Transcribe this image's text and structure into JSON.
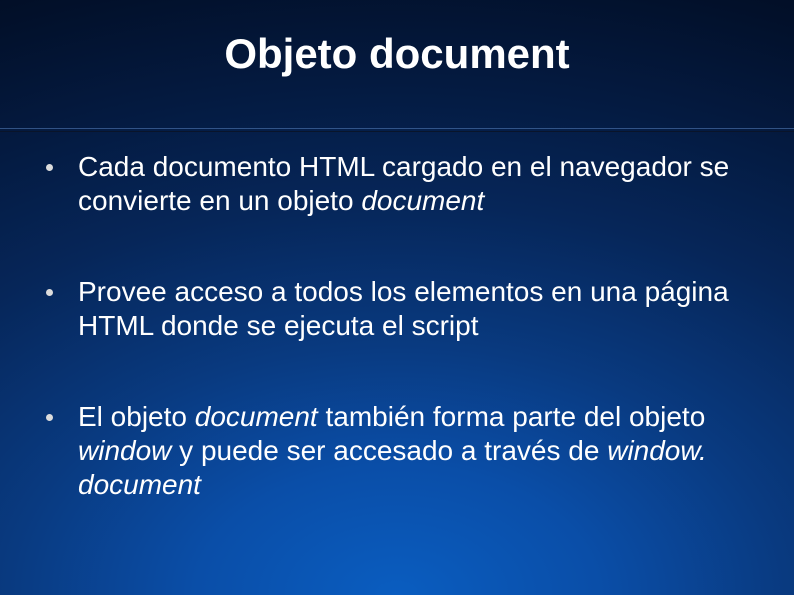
{
  "title": "Objeto document",
  "bullets": [
    {
      "segments": [
        {
          "text": "Cada documento HTML cargado en el navegador se convierte en un objeto ",
          "italic": false
        },
        {
          "text": "document",
          "italic": true
        }
      ]
    },
    {
      "segments": [
        {
          "text": "Provee acceso a todos los elementos en una página HTML donde se ejecuta el script",
          "italic": false
        }
      ]
    },
    {
      "segments": [
        {
          "text": "El objeto ",
          "italic": false
        },
        {
          "text": "document",
          "italic": true
        },
        {
          "text": " también forma parte del objeto ",
          "italic": false
        },
        {
          "text": "window",
          "italic": true
        },
        {
          "text": " y puede ser accesado a través de ",
          "italic": false
        },
        {
          "text": "window. document",
          "italic": true
        }
      ]
    }
  ]
}
